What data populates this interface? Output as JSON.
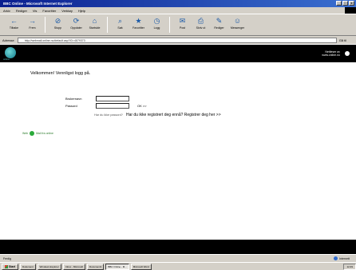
{
  "window": {
    "title": "BBC Online - Microsoft Internet Explorer",
    "buttons": [
      "_",
      "□",
      "x"
    ]
  },
  "menu": [
    "Arkiv",
    "Rediger",
    "Vis",
    "Favoritter",
    "Verktøy",
    "Hjelp"
  ],
  "toolbar": [
    {
      "label": "Tilbake",
      "icon": "back-arrow-icon",
      "glyph": "←"
    },
    {
      "label": "Frem",
      "icon": "forward-arrow-icon",
      "glyph": "→"
    },
    {
      "label": "Stopp",
      "icon": "stop-icon",
      "glyph": "⊘"
    },
    {
      "label": "Oppdater",
      "icon": "refresh-icon",
      "glyph": "⟳"
    },
    {
      "label": "Startside",
      "icon": "home-icon",
      "glyph": "⌂"
    },
    {
      "label": "Søk",
      "icon": "search-icon",
      "glyph": "⌕"
    },
    {
      "label": "Favoritter",
      "icon": "favorites-icon",
      "glyph": "★"
    },
    {
      "label": "Logg",
      "icon": "history-icon",
      "glyph": "◷"
    },
    {
      "label": "Post",
      "icon": "mail-icon",
      "glyph": "✉"
    },
    {
      "label": "Skriv ut",
      "icon": "print-icon",
      "glyph": "⎙"
    },
    {
      "label": "Rediger",
      "icon": "edit-icon",
      "glyph": "✎"
    },
    {
      "label": "Messenger",
      "icon": "messenger-icon",
      "glyph": "☺"
    }
  ],
  "address": {
    "label": "Adresse",
    "value": "http://webmail.online.no/default.asp?ID=4879373",
    "go": "Gå til"
  },
  "header": {
    "brand": "online",
    "right_line1": "Nettleser av",
    "right_line2": "www.online.no"
  },
  "login": {
    "welcome": "Velkommen! Vennligst logg på.",
    "username_label": "Brukernavn",
    "password_label": "Passord",
    "ok": "OK >>",
    "register_small": "Har du ikke passord?",
    "register_big": "Har du ikke registrert deg ennå? Registrer deg her >>"
  },
  "webmail": {
    "prefix": "Web",
    "link": "Mail fra online"
  },
  "status": {
    "left": "Ferdig",
    "zone": "Internett"
  },
  "taskbar": {
    "start": "Start",
    "tasks": [
      "Dokument",
      "Windows Explorer",
      "Inbox - Microsoft",
      "Document1",
      "BBC Online - M...",
      "Microsoft Word"
    ],
    "active_index": 4,
    "time": "12:49"
  }
}
